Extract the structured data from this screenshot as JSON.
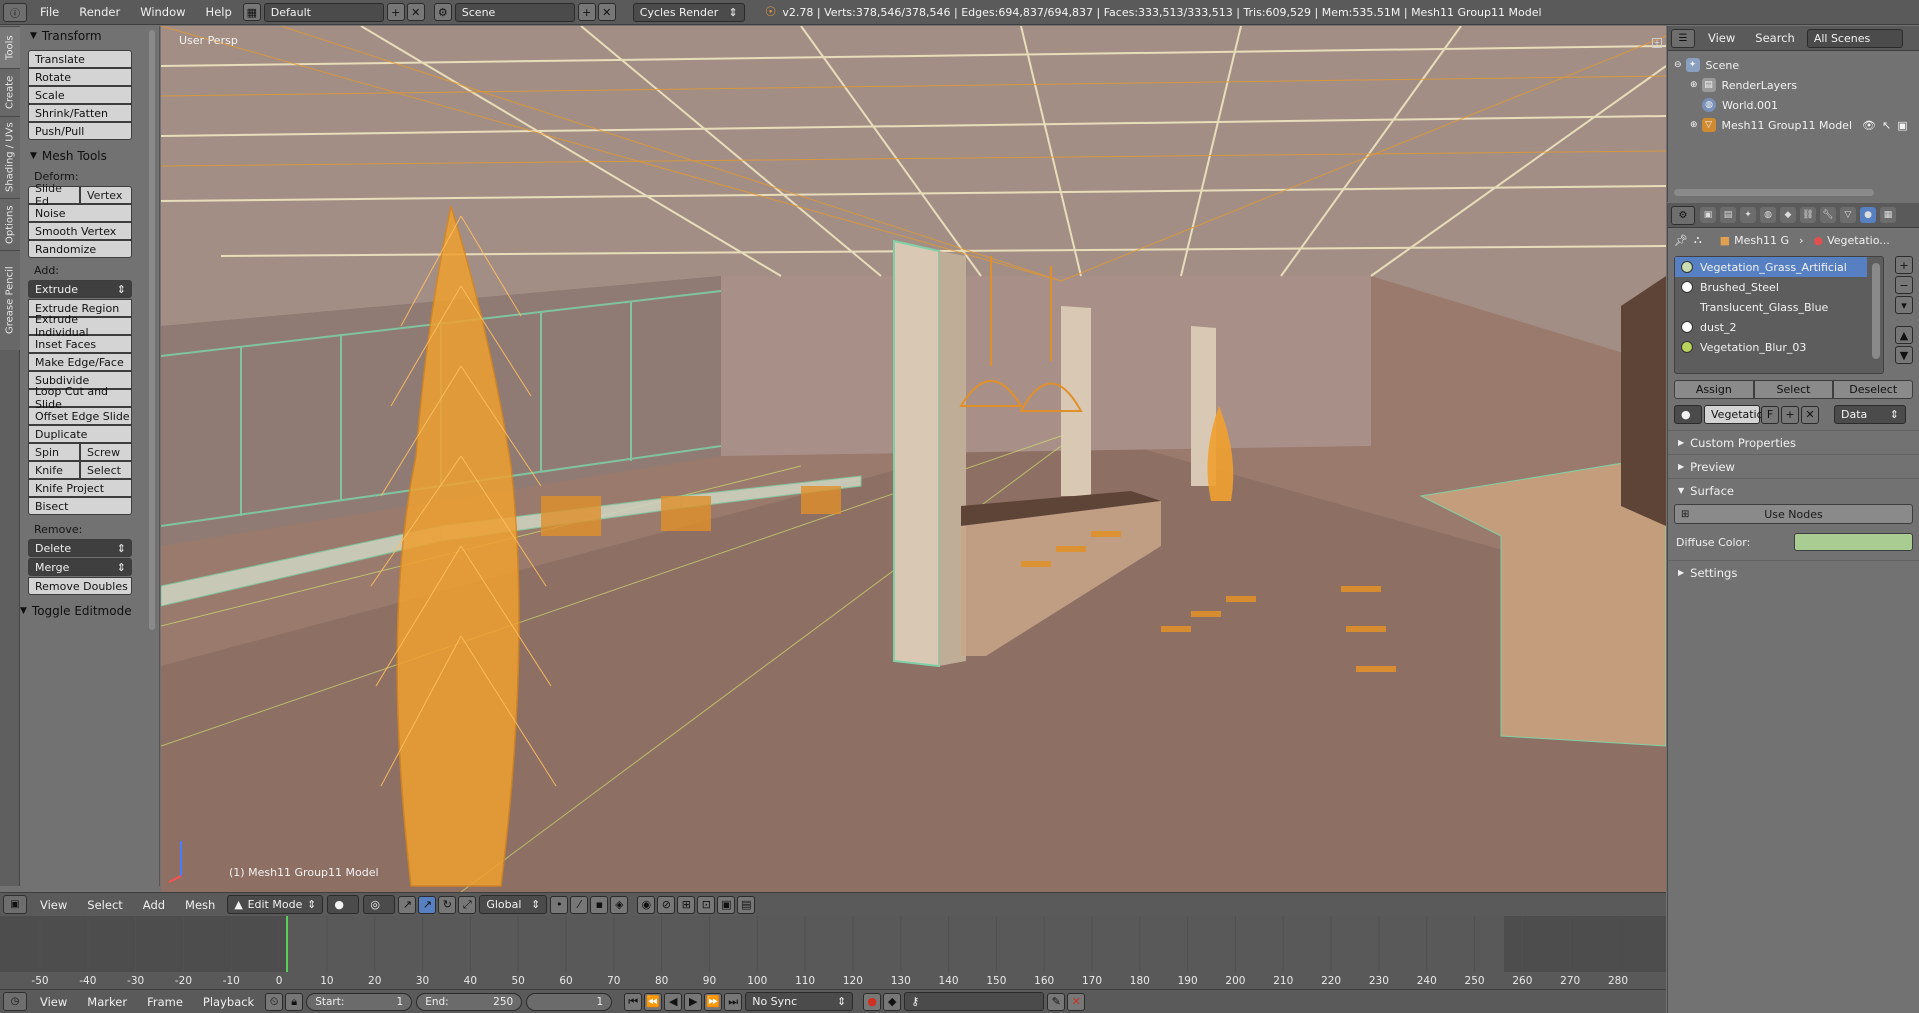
{
  "topbar": {
    "menus": [
      "File",
      "Render",
      "Window",
      "Help"
    ],
    "layout": "Default",
    "scene": "Scene",
    "engine": "Cycles Render",
    "stats": "v2.78 | Verts:378,546/378,546 | Edges:694,837/694,837 | Faces:333,513/333,513 | Tris:609,529 | Mem:535.51M | Mesh11 Group11 Model"
  },
  "left_tabs": [
    "Tools",
    "Create",
    "Shading / UVs",
    "Options",
    "Grease Pencil"
  ],
  "toolshelf": {
    "transform": {
      "title": "Transform",
      "buttons": [
        "Translate",
        "Rotate",
        "Scale",
        "Shrink/Fatten",
        "Push/Pull"
      ]
    },
    "mesh_tools": {
      "title": "Mesh Tools",
      "deform_label": "Deform:",
      "slide_edge": "Slide Ed",
      "vertex": "Vertex",
      "deform_buttons": [
        "Noise",
        "Smooth Vertex",
        "Randomize"
      ],
      "add_label": "Add:",
      "extrude": "Extrude",
      "add_buttons": [
        "Extrude Region",
        "Extrude Individual",
        "Inset Faces",
        "Make Edge/Face",
        "Subdivide",
        "Loop Cut and Slide",
        "Offset Edge Slide",
        "Duplicate"
      ],
      "spin": "Spin",
      "screw": "Screw",
      "knife": "Knife",
      "select": "Select",
      "knife_project": "Knife Project",
      "bisect": "Bisect",
      "remove_label": "Remove:",
      "delete": "Delete",
      "merge": "Merge",
      "remove_doubles": "Remove Doubles"
    },
    "toggle_editmode": "Toggle Editmode"
  },
  "viewport": {
    "view_label": "User Persp",
    "object_label": "(1) Mesh11 Group11 Model"
  },
  "view3d_header": {
    "menus": [
      "View",
      "Select",
      "Add",
      "Mesh"
    ],
    "mode": "Edit Mode",
    "orientation": "Global"
  },
  "timeline": {
    "ticks": [
      "-50",
      "-40",
      "-30",
      "-20",
      "-10",
      "0",
      "10",
      "20",
      "30",
      "40",
      "50",
      "60",
      "70",
      "80",
      "90",
      "100",
      "110",
      "120",
      "130",
      "140",
      "150",
      "160",
      "170",
      "180",
      "190",
      "200",
      "210",
      "220",
      "230",
      "240",
      "250",
      "260",
      "270",
      "280"
    ],
    "menus": [
      "View",
      "Marker",
      "Frame",
      "Playback"
    ],
    "start_label": "Start:",
    "start": "1",
    "end_label": "End:",
    "end": "250",
    "current": "1",
    "sync": "No Sync"
  },
  "outliner": {
    "view": "View",
    "search": "Search",
    "scope": "All Scenes",
    "items": [
      "Scene",
      "RenderLayers",
      "World.001",
      "Mesh11 Group11 Model"
    ]
  },
  "properties": {
    "breadcrumb_object": "Mesh11 G",
    "breadcrumb_material": "Vegetatio...",
    "materials": [
      "Vegetation_Grass_Artificial",
      "Brushed_Steel",
      "Translucent_Glass_Blue",
      "dust_2",
      "Vegetation_Blur_03"
    ],
    "material_colors": [
      "#c9ddb0",
      "#ffffff",
      "",
      "#ffffff",
      "#b8d25a"
    ],
    "assign": "Assign",
    "select": "Select",
    "deselect": "Deselect",
    "material_name": "Vegetatio",
    "fake_user": "F",
    "link": "Data",
    "panels": {
      "custom_properties": "Custom Properties",
      "preview": "Preview",
      "surface": "Surface",
      "use_nodes": "Use Nodes",
      "diffuse_label": "Diffuse Color:",
      "diffuse_color": "#a9cc92",
      "settings": "Settings"
    }
  }
}
